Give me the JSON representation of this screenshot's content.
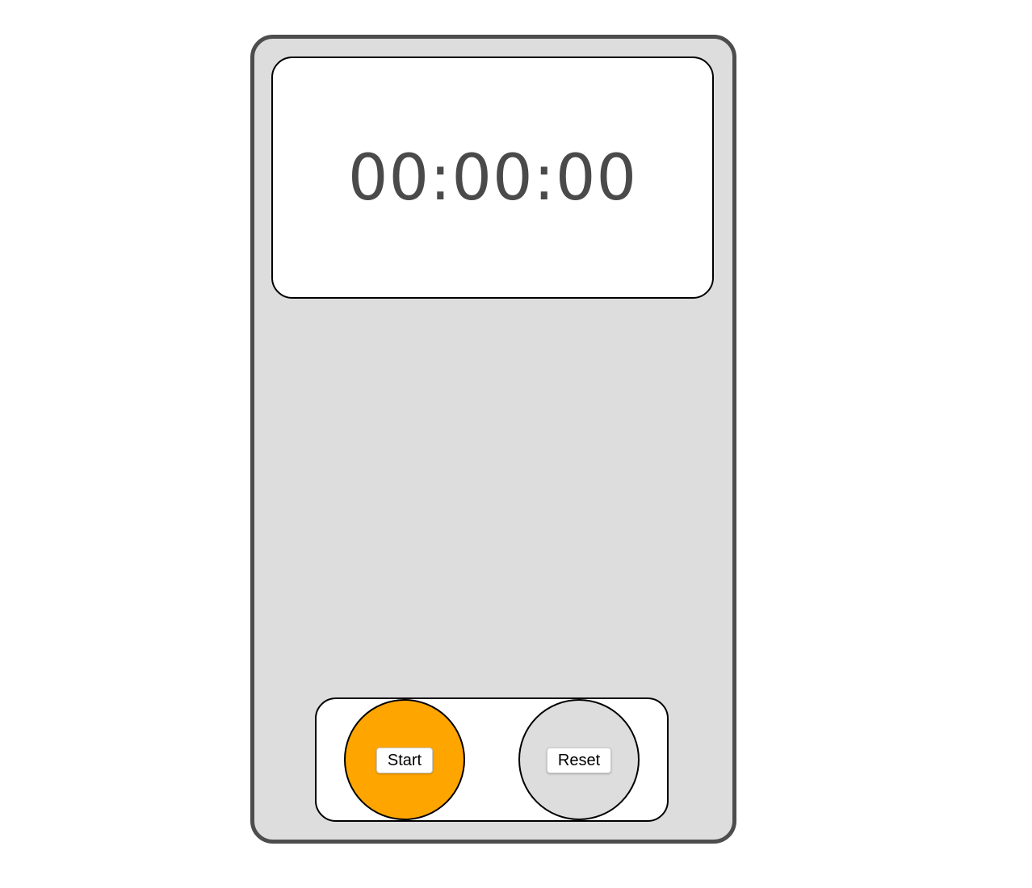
{
  "display": {
    "time": "00:00:00"
  },
  "controls": {
    "start_label": "Start",
    "reset_label": "Reset",
    "start_color": "#ffa500",
    "reset_color": "#dddddd"
  },
  "colors": {
    "frame_border": "#4d4d4d",
    "frame_background": "#dddddd",
    "time_text": "#4a4a4a"
  }
}
